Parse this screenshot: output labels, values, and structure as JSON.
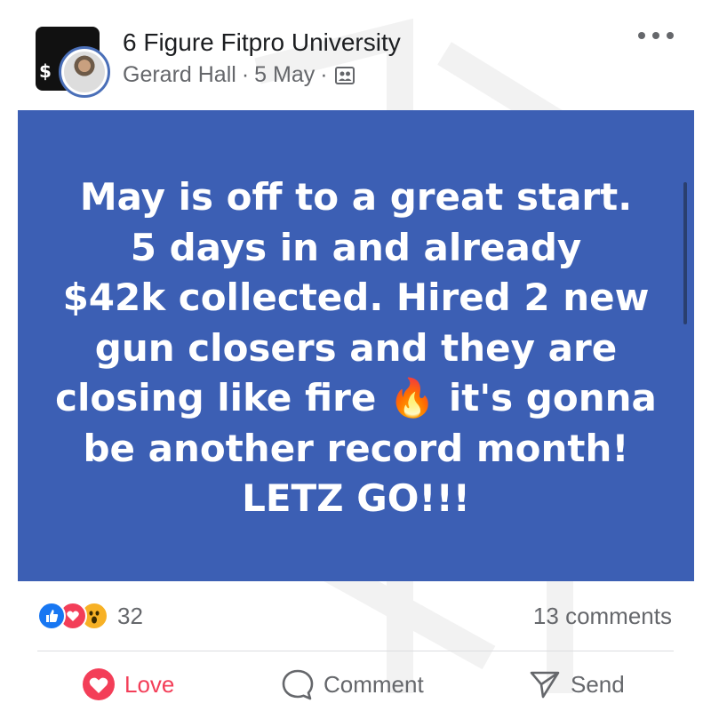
{
  "post": {
    "group_name": "6 Figure Fitpro University",
    "author": "Gerard Hall",
    "date": "5 May",
    "separator": "·",
    "privacy_icon": "group-privacy-icon",
    "text_lines": [
      "May is off to a great start.",
      "5 days in and already",
      "$42k collected. Hired 2 new",
      "gun closers and they are",
      "closing like fire 🔥 it's gonna",
      "be another record month!",
      "LETZ GO!!!"
    ],
    "background_color": "#3c5fb4"
  },
  "engagement": {
    "reaction_icons": [
      "like-icon",
      "love-icon",
      "wow-icon"
    ],
    "reaction_count": "32",
    "comments": "13 comments"
  },
  "actions": {
    "love": "Love",
    "comment": "Comment",
    "send": "Send"
  },
  "colors": {
    "love_red": "#f33e58",
    "like_blue": "#1877f2",
    "wow_yellow": "#f7b125",
    "meta_gray": "#65676b"
  }
}
